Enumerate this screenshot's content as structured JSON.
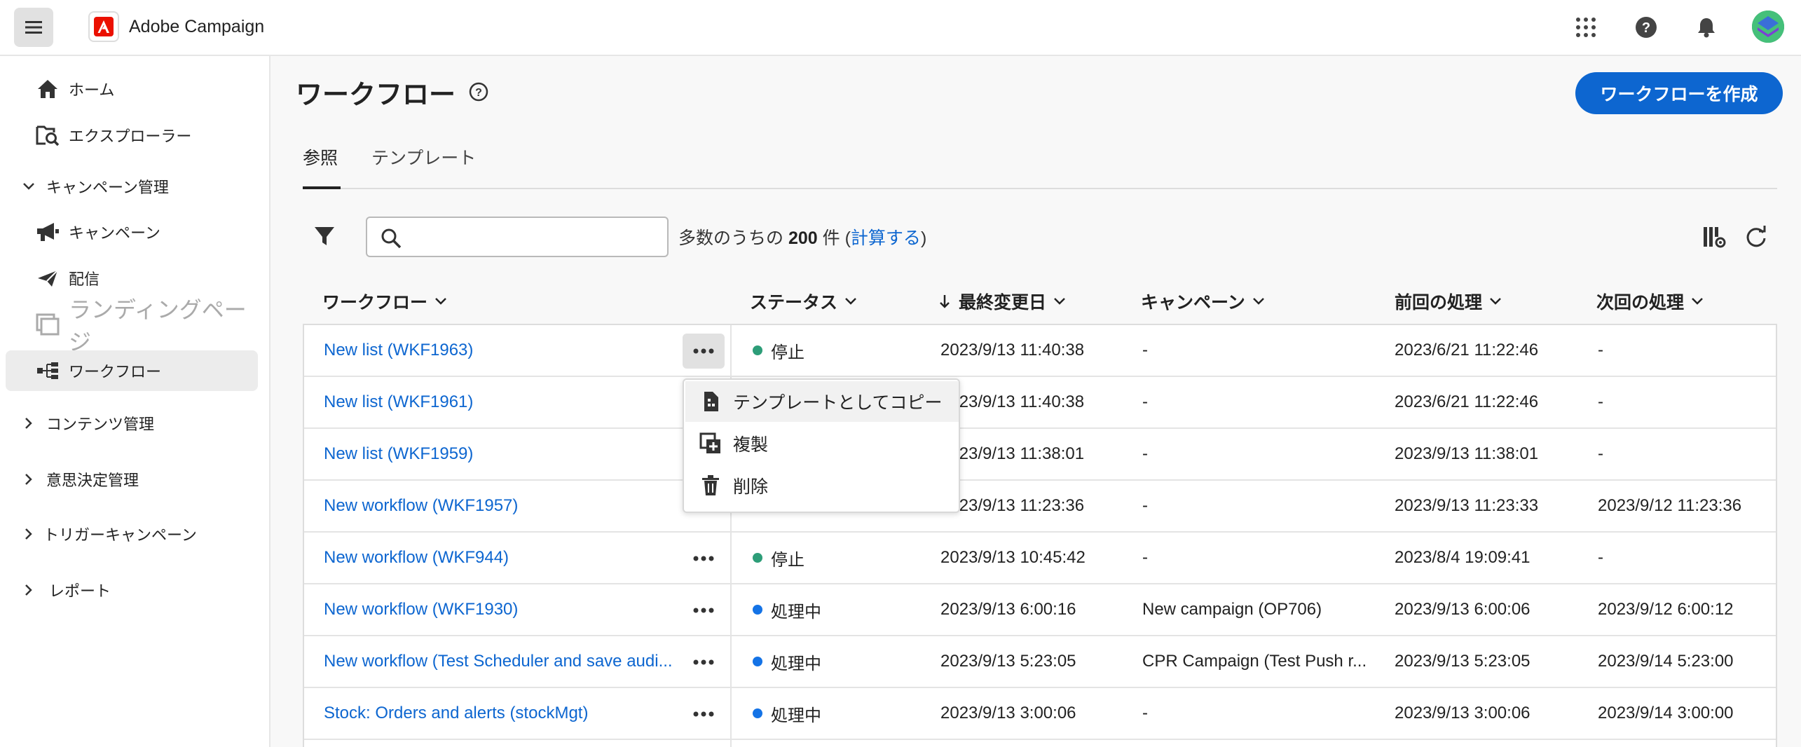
{
  "header": {
    "app_name": "Adobe Campaign"
  },
  "sidebar": {
    "items": [
      {
        "label": "ホーム",
        "icon": "home-icon"
      },
      {
        "label": "エクスプローラー",
        "icon": "explorer-icon"
      },
      {
        "label": "キャンペーン管理",
        "icon": "chevron-down-icon"
      },
      {
        "label": "キャンペーン",
        "icon": "megaphone-icon"
      },
      {
        "label": "配信",
        "icon": "send-icon"
      },
      {
        "label": "ランディングページ",
        "icon": "landing-page-icon"
      },
      {
        "label": "ワークフロー",
        "icon": "workflow-icon"
      },
      {
        "label": "コンテンツ管理",
        "icon": "chevron-right-icon"
      },
      {
        "label": "意思決定管理",
        "icon": "chevron-right-icon"
      },
      {
        "label": "トリガーキャンペーン",
        "icon": "chevron-right-icon"
      },
      {
        "label": "レポート",
        "icon": "chevron-right-icon"
      }
    ]
  },
  "main": {
    "title": "ワークフロー",
    "create_button": "ワークフローを作成",
    "tabs": [
      "参照",
      "テンプレート"
    ],
    "search_placeholder": "",
    "count": {
      "prefix": "多数のうちの",
      "number": "200",
      "suffix": "件 (",
      "link": "計算する",
      "close": ")"
    }
  },
  "table": {
    "columns": [
      "ワークフロー",
      "ステータス",
      "最終変更日",
      "キャンペーン",
      "前回の処理",
      "次回の処理"
    ],
    "rows": [
      {
        "name": "New list (WKF1963)",
        "status": "停止",
        "modified": "2023/9/13 11:40:38",
        "campaign": "-",
        "last": "2023/6/21 11:22:46",
        "next": "-"
      },
      {
        "name": "New list (WKF1961)",
        "status": "",
        "modified": "2023/9/13 11:40:38",
        "campaign": "-",
        "last": "2023/6/21 11:22:46",
        "next": "-"
      },
      {
        "name": "New list (WKF1959)",
        "status": "",
        "modified": "2023/9/13 11:38:01",
        "campaign": "-",
        "last": "2023/9/13 11:38:01",
        "next": "-"
      },
      {
        "name": "New workflow (WKF1957)",
        "status": "",
        "modified": "2023/9/13 11:23:36",
        "campaign": "-",
        "last": "2023/9/13 11:23:33",
        "next": "2023/9/12 11:23:36"
      },
      {
        "name": "New workflow (WKF944)",
        "status": "停止",
        "modified": "2023/9/13 10:45:42",
        "campaign": "-",
        "last": "2023/8/4 19:09:41",
        "next": "-"
      },
      {
        "name": "New workflow (WKF1930)",
        "status": "処理中",
        "modified": "2023/9/13 6:00:16",
        "campaign": "New campaign (OP706)",
        "last": "2023/9/13 6:00:06",
        "next": "2023/9/12 6:00:12"
      },
      {
        "name": "New workflow (Test Scheduler and save audi...",
        "status": "処理中",
        "modified": "2023/9/13 5:23:05",
        "campaign": "CPR Campaign (Test Push r...",
        "last": "2023/9/13 5:23:05",
        "next": "2023/9/14 5:23:00"
      },
      {
        "name": "Stock: Orders and alerts (stockMgt)",
        "status": "処理中",
        "modified": "2023/9/13 3:00:06",
        "campaign": "-",
        "last": "2023/9/13 3:00:06",
        "next": "2023/9/14 3:00:00"
      }
    ]
  },
  "context_menu": {
    "items": [
      {
        "label": "テンプレートとしてコピー",
        "icon": "copy-template-icon"
      },
      {
        "label": "複製",
        "icon": "duplicate-icon"
      },
      {
        "label": "削除",
        "icon": "delete-icon"
      }
    ]
  },
  "colors": {
    "accent": "#0d66d0",
    "status_stopped": "#2d9d78",
    "status_running": "#1473e6"
  }
}
